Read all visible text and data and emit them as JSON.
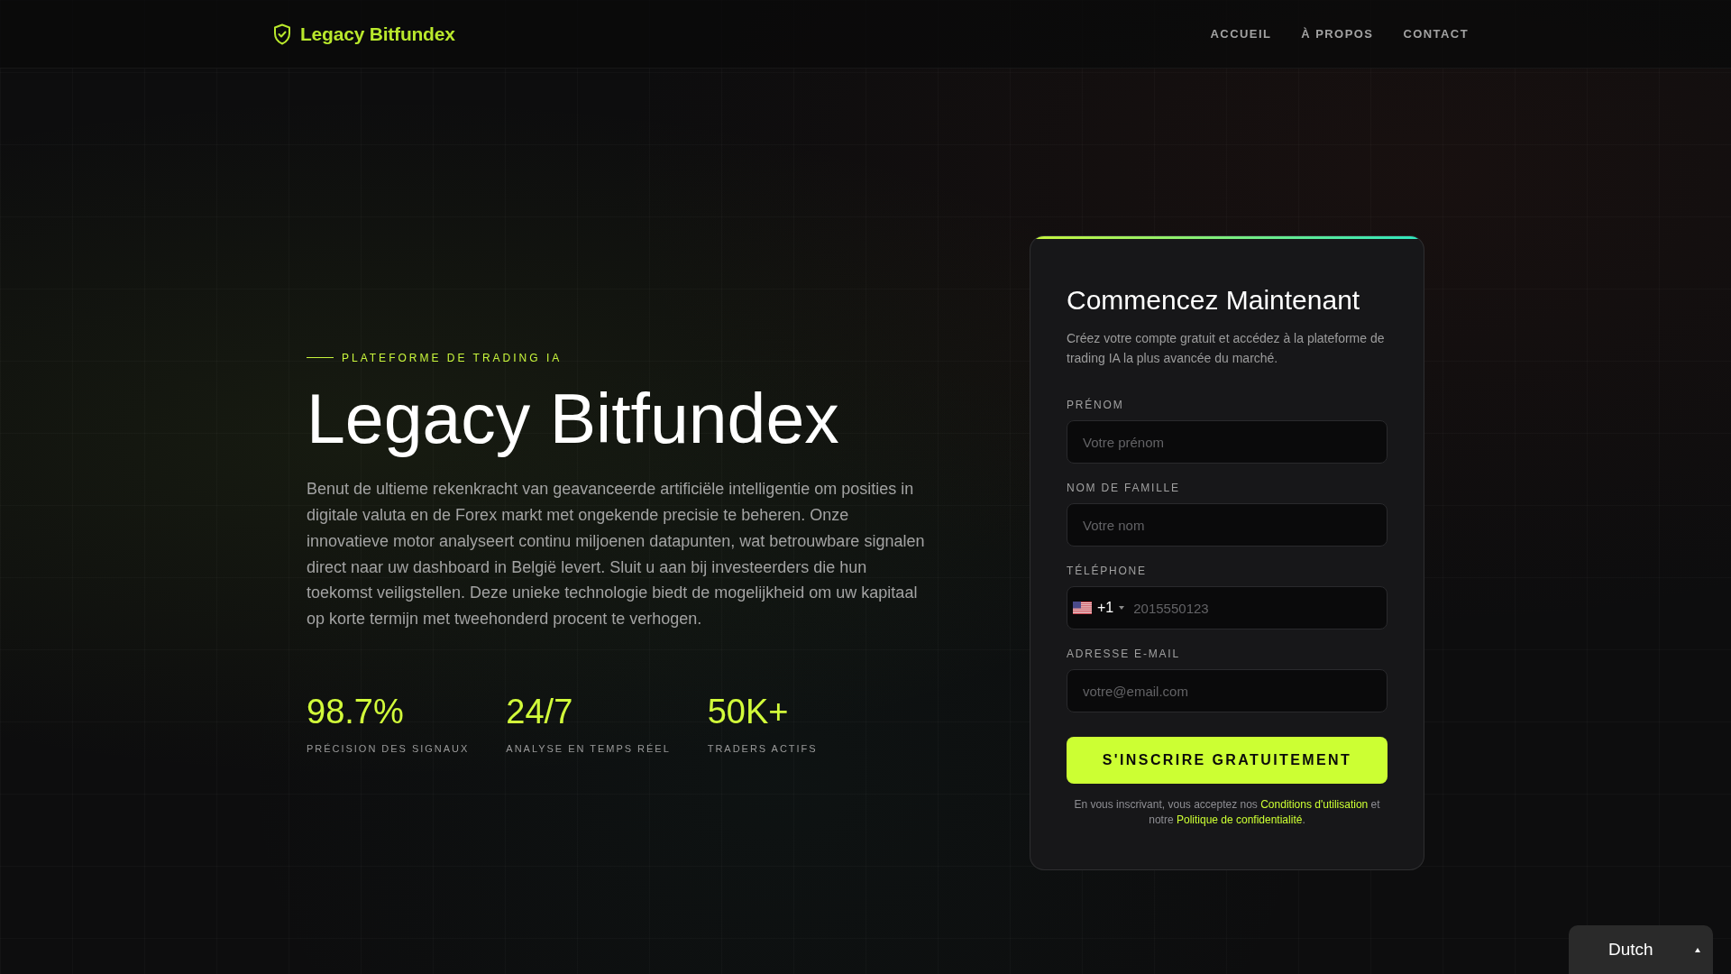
{
  "header": {
    "logo": "Legacy Bitfundex",
    "nav": [
      {
        "label": "ACCUEIL"
      },
      {
        "label": "À PROPOS"
      },
      {
        "label": "CONTACT"
      }
    ]
  },
  "hero": {
    "eyebrow": "PLATEFORME DE TRADING IA",
    "title": "Legacy Bitfundex",
    "description": "Benut de ultieme rekenkracht van geavanceerde artificiële intelligentie om posities in digitale valuta en de Forex markt met ongekende precisie te beheren. Onze innovatieve motor analyseert continu miljoenen datapunten, wat betrouwbare signalen direct naar uw dashboard in België levert. Sluit u aan bij investeerders die hun toekomst veiligstellen. Deze unieke technologie biedt de mogelijkheid om uw kapitaal op korte termijn met tweehonderd procent te verhogen.",
    "stats": [
      {
        "value": "98.7%",
        "label": "PRÉCISION DES SIGNAUX"
      },
      {
        "value": "24/7",
        "label": "ANALYSE EN TEMPS RÉEL"
      },
      {
        "value": "50K+",
        "label": "TRADERS ACTIFS"
      }
    ]
  },
  "signup_form": {
    "title": "Commencez Maintenant",
    "subtitle": "Créez votre compte gratuit et accédez à la plateforme de trading IA la plus avancée du marché.",
    "fields": [
      {
        "kind": "text",
        "label": "PRÉNOM",
        "placeholder": "Votre prénom"
      },
      {
        "kind": "text",
        "label": "NOM DE FAMILLE",
        "placeholder": "Votre nom"
      },
      {
        "kind": "phone",
        "label": "TÉLÉPHONE",
        "country_code": "+1",
        "placeholder": "2015550123"
      },
      {
        "kind": "text",
        "label": "ADRESSE E-MAIL",
        "placeholder": "votre@email.com"
      }
    ],
    "submit": "S'INSCRIRE GRATUITEMENT",
    "terms": [
      {
        "kind": "text",
        "text": "En vous inscrivant, vous acceptez nos "
      },
      {
        "kind": "link",
        "text": "Conditions d'utilisation"
      },
      {
        "kind": "text",
        "text": " et notre "
      },
      {
        "kind": "link",
        "text": "Politique de confidentialité"
      },
      {
        "kind": "text",
        "text": "."
      }
    ]
  },
  "language_selector": {
    "label": "Dutch"
  }
}
